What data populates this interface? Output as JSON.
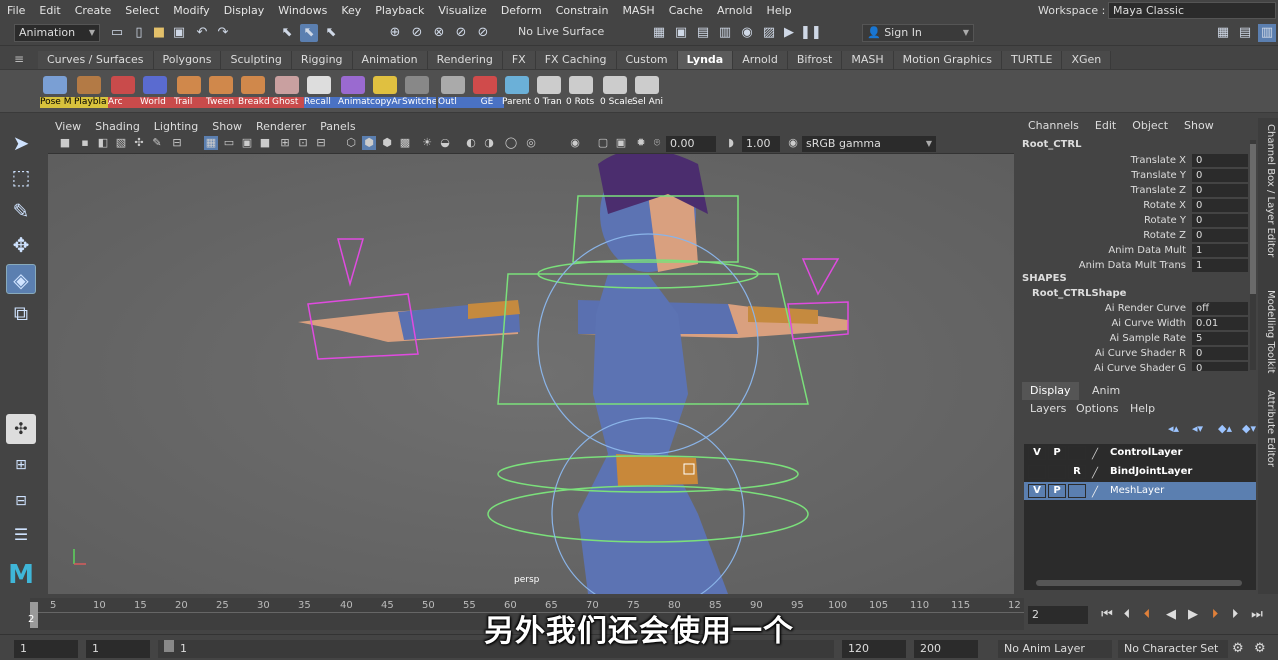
{
  "menubar": {
    "items": [
      "File",
      "Edit",
      "Create",
      "Select",
      "Modify",
      "Display",
      "Windows",
      "Key",
      "Playback",
      "Visualize",
      "Deform",
      "Constrain",
      "MASH",
      "Cache",
      "Arnold",
      "Help"
    ],
    "workspace_label": "Workspace :",
    "workspace_value": "Maya Classic"
  },
  "statusline": {
    "menuset": "Animation",
    "live_surface": "No Live Surface",
    "sign_in": "Sign In"
  },
  "shelf": {
    "tabs": [
      "Curves / Surfaces",
      "Polygons",
      "Sculpting",
      "Rigging",
      "Animation",
      "Rendering",
      "FX",
      "FX Caching",
      "Custom",
      "Lynda",
      "Arnold",
      "Bifrost",
      "MASH",
      "Motion Graphics",
      "TURTLE",
      "XGen"
    ],
    "active_tab": "Lynda",
    "buttons": [
      "Pose M",
      "Playbla",
      "Arc",
      "World",
      "Trail",
      "Tween",
      "Breakd",
      "Ghost",
      "Recall",
      "Animat",
      "copyAr",
      "Switche",
      "Outl",
      "GE",
      "Parent",
      "0 Tran",
      "0 Rots",
      "0 Scale",
      "Sel Ani"
    ]
  },
  "panel": {
    "menu": [
      "View",
      "Shading",
      "Lighting",
      "Show",
      "Renderer",
      "Panels"
    ],
    "near_clip": "0.00",
    "far_clip": "1.00",
    "color_space": "sRGB gamma",
    "camera_label": "persp"
  },
  "channelbox": {
    "menu": [
      "Channels",
      "Edit",
      "Object",
      "Show"
    ],
    "object": "Root_CTRL",
    "attrs": [
      {
        "name": "Translate X",
        "value": "0"
      },
      {
        "name": "Translate Y",
        "value": "0"
      },
      {
        "name": "Translate Z",
        "value": "0"
      },
      {
        "name": "Rotate X",
        "value": "0"
      },
      {
        "name": "Rotate Y",
        "value": "0"
      },
      {
        "name": "Rotate Z",
        "value": "0"
      },
      {
        "name": "Anim Data Mult",
        "value": "1"
      },
      {
        "name": "Anim Data Mult Trans",
        "value": "1"
      }
    ],
    "shapes_label": "SHAPES",
    "shape_name": "Root_CTRLShape",
    "shape_attrs": [
      {
        "name": "Ai Render Curve",
        "value": "off"
      },
      {
        "name": "Ai Curve Width",
        "value": "0.01"
      },
      {
        "name": "Ai Sample Rate",
        "value": "5"
      },
      {
        "name": "Ai Curve Shader R",
        "value": "0"
      },
      {
        "name": "Ai Curve Shader G",
        "value": "0"
      }
    ]
  },
  "side_tabs": [
    "Channel Box / Layer Editor",
    "Modelling Toolkit",
    "Attribute Editor"
  ],
  "layers": {
    "tabs": [
      "Display",
      "Anim"
    ],
    "menu": [
      "Layers",
      "Options",
      "Help"
    ],
    "rows": [
      {
        "v": "V",
        "p": "P",
        "r": "",
        "name": "ControlLayer"
      },
      {
        "v": "",
        "p": "",
        "r": "R",
        "name": "BindJointLayer"
      },
      {
        "v": "V",
        "p": "P",
        "r": "",
        "name": "MeshLayer"
      }
    ]
  },
  "timeslider": {
    "ticks": [
      "5",
      "10",
      "15",
      "20",
      "25",
      "30",
      "35",
      "40",
      "45",
      "50",
      "55",
      "60",
      "65",
      "70",
      "75",
      "80",
      "85",
      "90",
      "95",
      "100",
      "105",
      "110",
      "115",
      "12"
    ],
    "current_frame_marker": "2",
    "current_frame": "2"
  },
  "range": {
    "start": "1",
    "playback_start": "1",
    "slider_value": "1",
    "playback_end": "120",
    "end": "200",
    "anim_layer": "No Anim Layer",
    "character_set": "No Character Set"
  },
  "subtitle": "另外我们还会使用一个",
  "colors": {
    "selected_layer": "#5b7fb0",
    "shelf_active_tab": "#5b5b5b",
    "viewport_bg": "#6a6a6a",
    "wire_green": "#7be07b",
    "wire_magenta": "#e04be0"
  }
}
